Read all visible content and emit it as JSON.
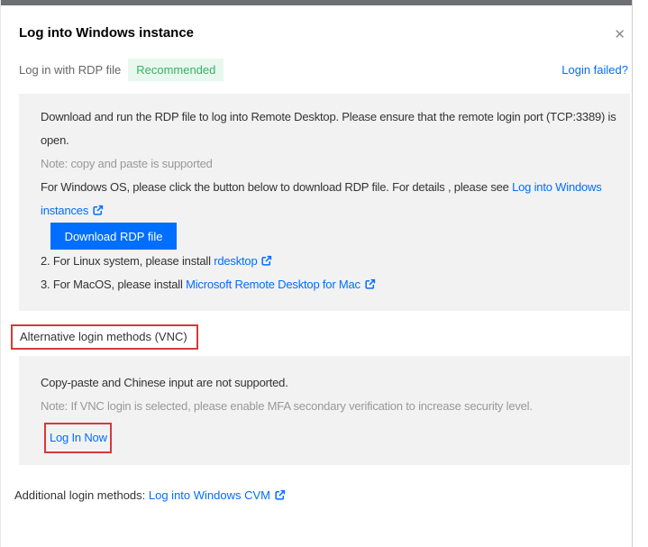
{
  "dialog": {
    "title": "Log into Windows instance",
    "close_glyph": "✕"
  },
  "rdp": {
    "label": "Log in with RDP file",
    "badge": "Recommended",
    "login_failed": "Login failed?",
    "instruction": "Download and run the RDP file to log into Remote Desktop. Please ensure that the remote login port (TCP:3389) is open.",
    "note": "Note: copy and paste is supported",
    "windows_prefix": "For Windows OS, please click the button below to download RDP file. For details , please see ",
    "windows_link": "Log into Windows instances",
    "download_button": "Download RDP file",
    "linux_prefix": "2. For Linux system, please install ",
    "linux_link": "rdesktop",
    "mac_prefix": "3. For MacOS, please install ",
    "mac_link": "Microsoft Remote Desktop for Mac"
  },
  "vnc": {
    "heading": "Alternative login methods (VNC)",
    "line1": "Copy-paste and Chinese input are not supported.",
    "note": "Note: If VNC login is selected, please enable MFA secondary verification to increase security level.",
    "login_link": "Log In Now"
  },
  "footer": {
    "prefix": "Additional login methods: ",
    "link": "Log into Windows CVM"
  },
  "colors": {
    "accent_blue": "#006eff",
    "badge_green_text": "#38b263",
    "badge_green_bg": "#e8f8ee",
    "annotation_red": "#d43a3a",
    "panel_gray": "#f2f2f2",
    "topbar_gray": "#6e6f72"
  }
}
